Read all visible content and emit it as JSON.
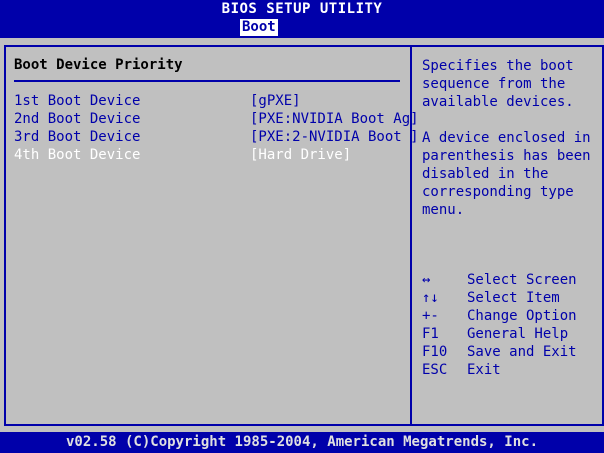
{
  "app": {
    "title": "BIOS SETUP UTILITY"
  },
  "tabs": {
    "active": "Boot"
  },
  "section": {
    "title": "Boot Device Priority"
  },
  "boot_devices": [
    {
      "label": "1st Boot Device",
      "value": "[gPXE]"
    },
    {
      "label": "2nd Boot Device",
      "value": "[PXE:NVIDIA Boot Ag]"
    },
    {
      "label": "3rd Boot Device",
      "value": "[PXE:2-NVIDIA Boot ]"
    },
    {
      "label": "4th Boot Device",
      "value": "[Hard Drive]"
    }
  ],
  "help": {
    "paragraph1": "Specifies the boot sequence from the available devices.",
    "paragraph2": "A device enclosed in parenthesis has been disabled in the corresponding type menu."
  },
  "keys": [
    {
      "icon": "↔",
      "icon_name": "left-right-arrows-icon",
      "action": "Select Screen"
    },
    {
      "icon": "↑↓",
      "icon_name": "up-down-arrows-icon",
      "action": "Select Item"
    },
    {
      "icon": "+-",
      "icon_name": "plus-minus-icon",
      "action": "Change Option"
    },
    {
      "icon": "F1",
      "action": "General Help"
    },
    {
      "icon": "F10",
      "action": "Save and Exit"
    },
    {
      "icon": "ESC",
      "action": "Exit"
    }
  ],
  "status": {
    "text": "v02.58 (C)Copyright 1985-2004, American Megatrends, Inc."
  },
  "colors": {
    "bios_blue": "#0000aa",
    "panel_gray": "#c0c0c0",
    "selected_text": "#ffffff"
  }
}
